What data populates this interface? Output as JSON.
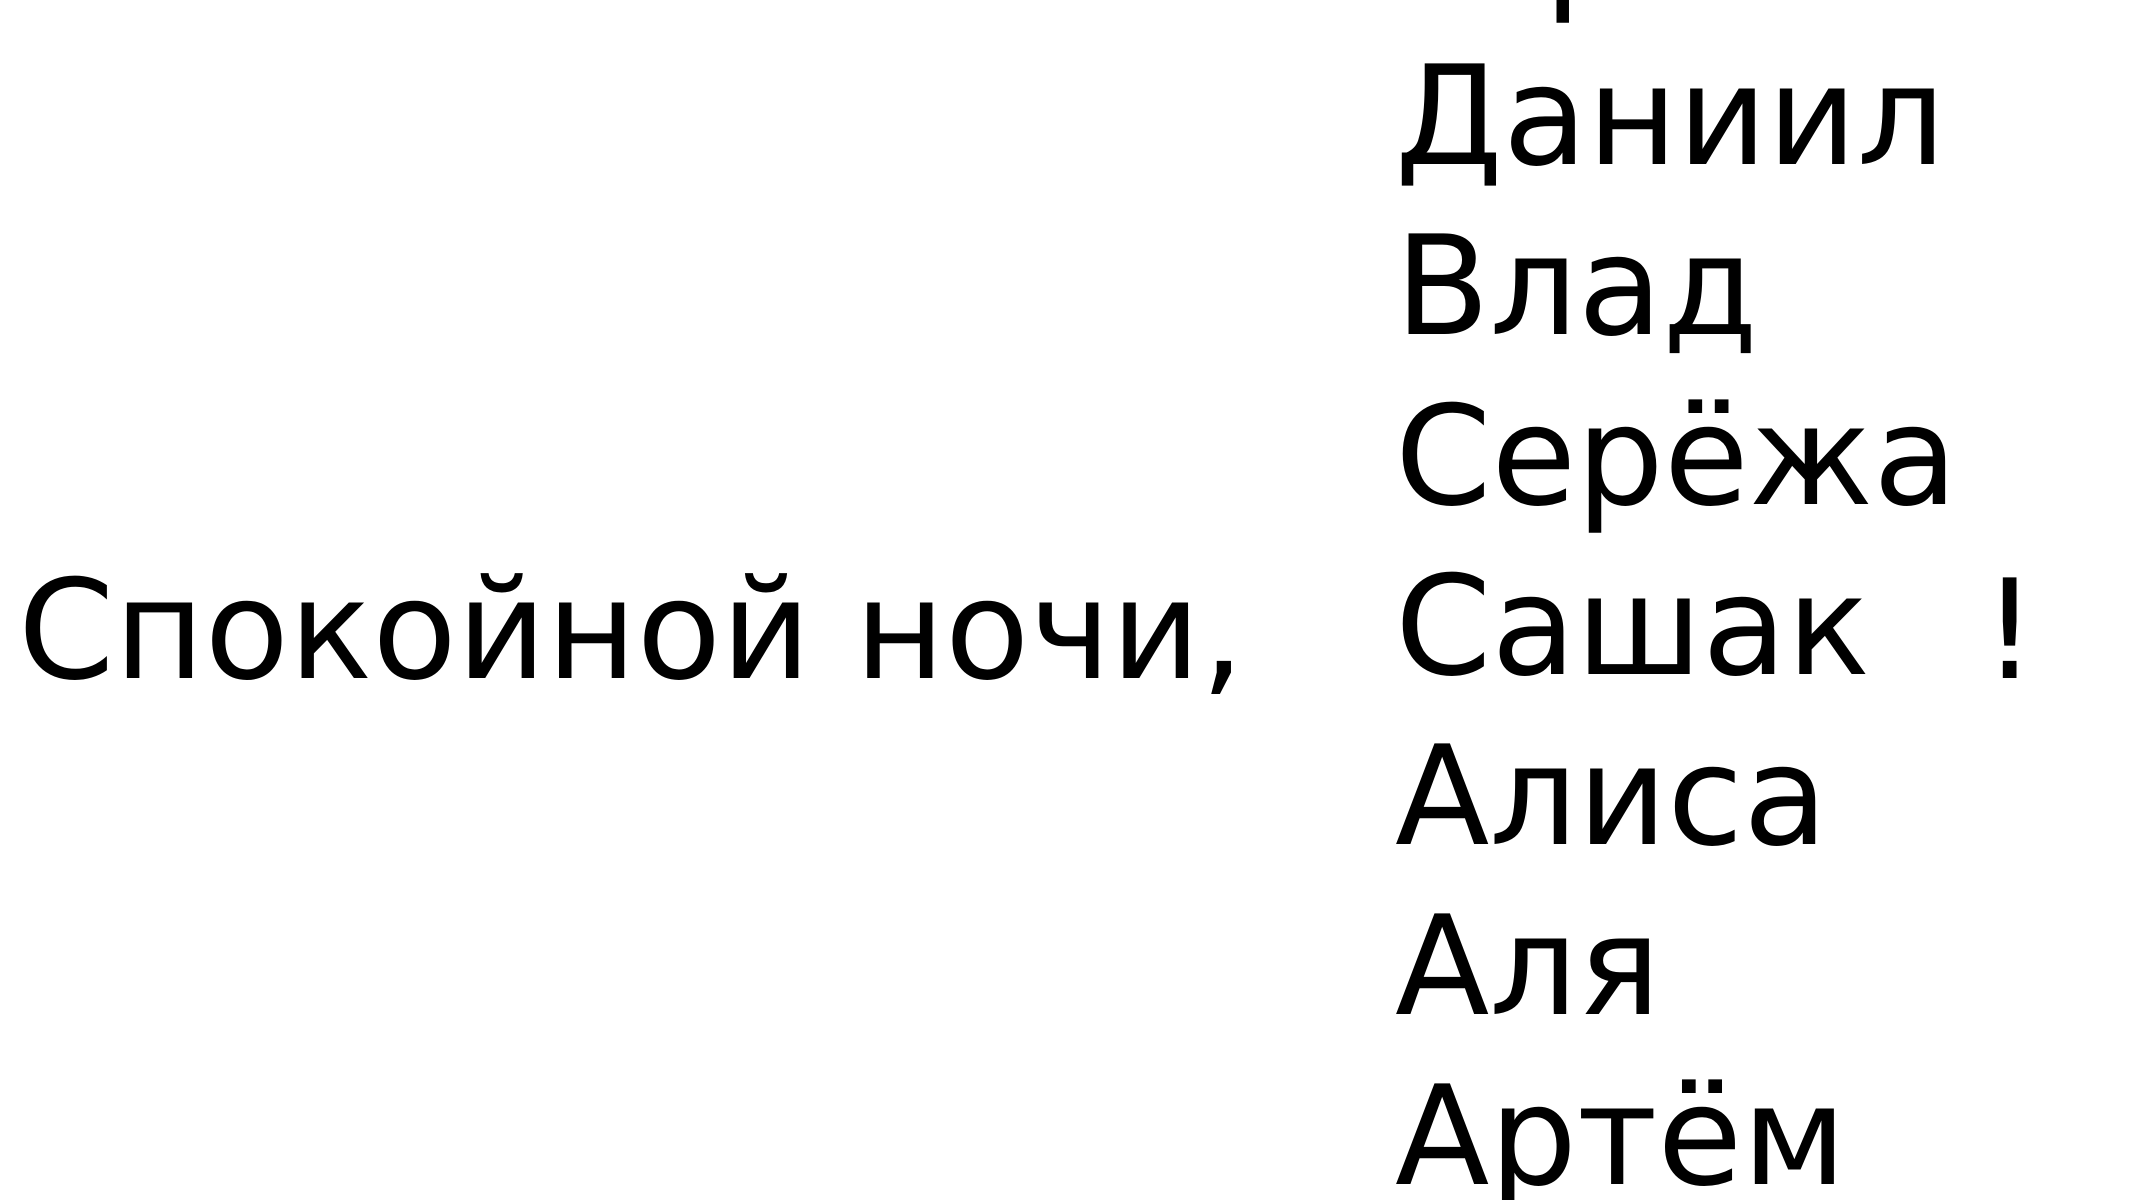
{
  "greeting": "Спокойной ночи,",
  "names": [
    "Юра",
    "Даниил",
    "Влад",
    "Серёжа",
    "Сашак",
    "Алиса",
    "Аля",
    "Артём"
  ],
  "exclamation": "!",
  "colors": {
    "text": "#000000",
    "background": "#ffffff"
  }
}
